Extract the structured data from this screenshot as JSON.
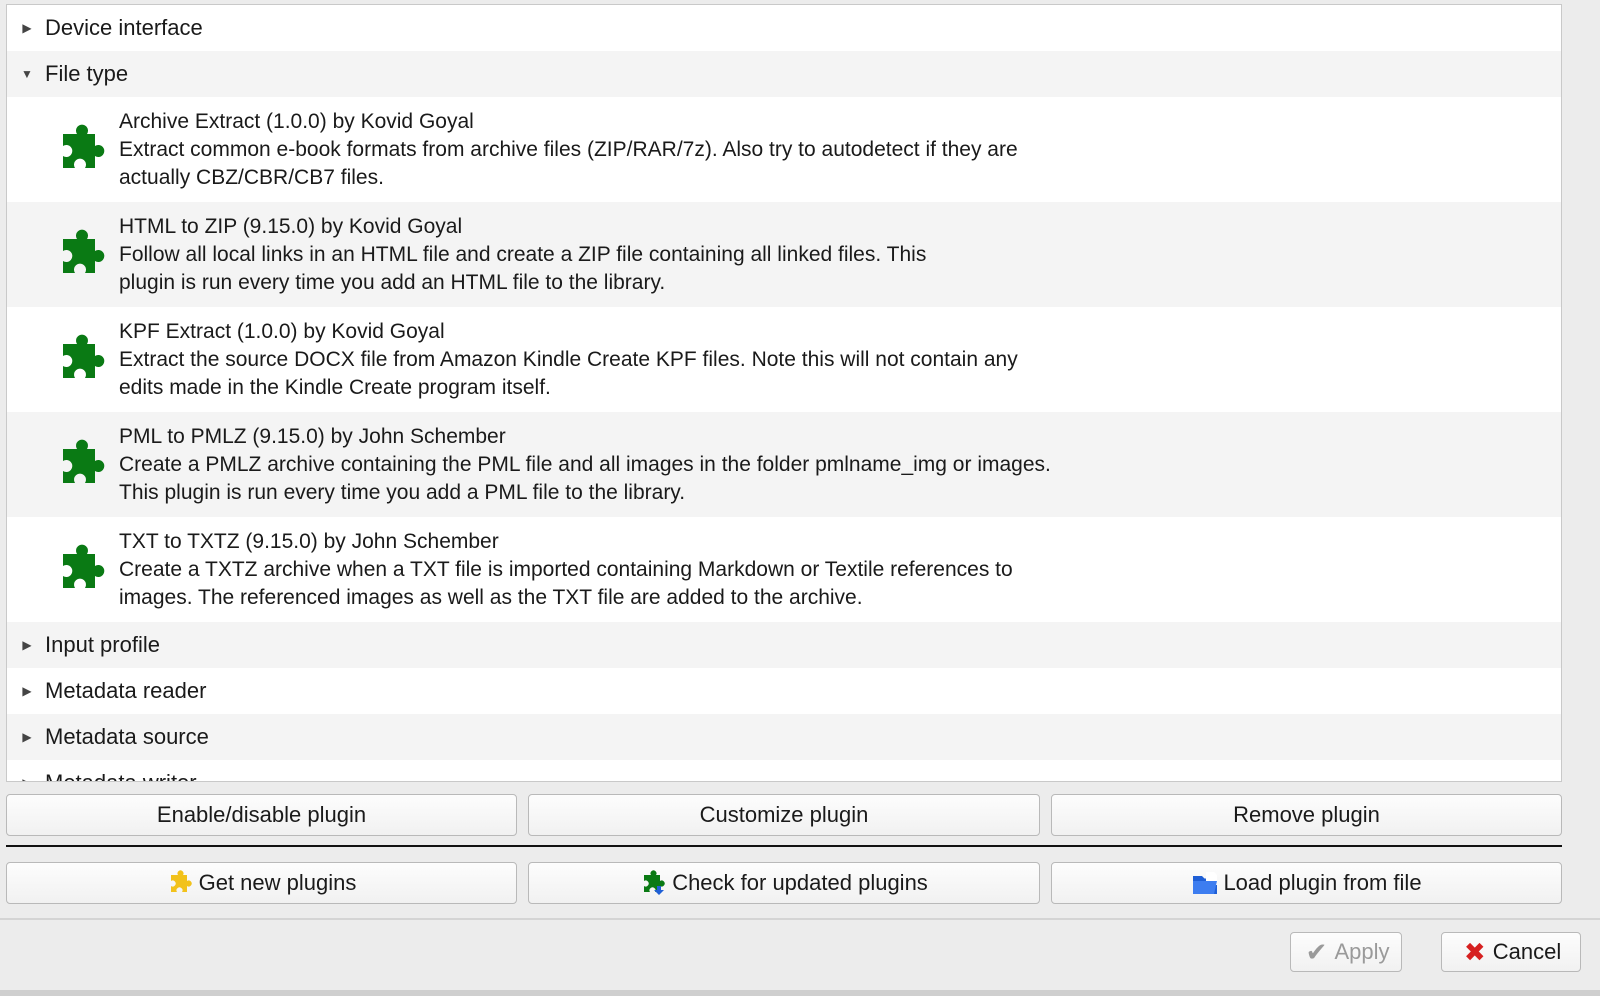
{
  "categories_top": [
    {
      "label": "Device interface",
      "expanded": false
    },
    {
      "label": "File type",
      "expanded": true
    }
  ],
  "plugins": [
    {
      "title": "Archive Extract (1.0.0) by Kovid Goyal",
      "desc1": "Extract common e-book formats from archive files (ZIP/RAR/7z). Also try to autodetect if they are",
      "desc2": "actually CBZ/CBR/CB7 files."
    },
    {
      "title": "HTML to ZIP (9.15.0) by Kovid Goyal",
      "desc1": "Follow all local links in an HTML file and create a ZIP file containing all linked files. This",
      "desc2": "plugin is run every time you add an HTML file to the library."
    },
    {
      "title": "KPF Extract (1.0.0) by Kovid Goyal",
      "desc1": "Extract the source DOCX file from Amazon Kindle Create KPF files. Note this will not contain any",
      "desc2": "edits made in the Kindle Create program itself."
    },
    {
      "title": "PML to PMLZ (9.15.0) by John Schember",
      "desc1": "Create a PMLZ archive containing the PML file and all images in the folder pmlname_img or images.",
      "desc2": "This plugin is run every time you add a PML file to the library."
    },
    {
      "title": "TXT to TXTZ (9.15.0) by John Schember",
      "desc1": "Create a TXTZ archive when a TXT file is imported containing Markdown or Textile references to",
      "desc2": "images. The referenced images as well as the TXT file are added to the archive."
    }
  ],
  "categories_bottom": [
    {
      "label": "Input profile",
      "expanded": false
    },
    {
      "label": "Metadata reader",
      "expanded": false
    },
    {
      "label": "Metadata source",
      "expanded": false
    },
    {
      "label": "Metadata writer",
      "expanded": false
    }
  ],
  "buttons": {
    "enable_disable": "Enable/disable plugin",
    "customize": "Customize plugin",
    "remove": "Remove plugin",
    "get_new": "Get new plugins",
    "check_updates": "Check for updated plugins",
    "load_from_file": "Load plugin from file",
    "apply": "Apply",
    "cancel": "Cancel"
  },
  "icons": {
    "plugin": "puzzle-piece-icon",
    "get_new": "yellow-puzzle-icon",
    "check_updates": "green-puzzle-download-icon",
    "load_from_file": "blue-folder-icon",
    "apply": "checkmark-icon",
    "cancel": "red-x-icon"
  },
  "colors": {
    "plugin_green": "#0a7a14",
    "cancel_red": "#d62020",
    "folder_blue": "#1f5fd6",
    "puzzle_yellow": "#f2c21b"
  }
}
